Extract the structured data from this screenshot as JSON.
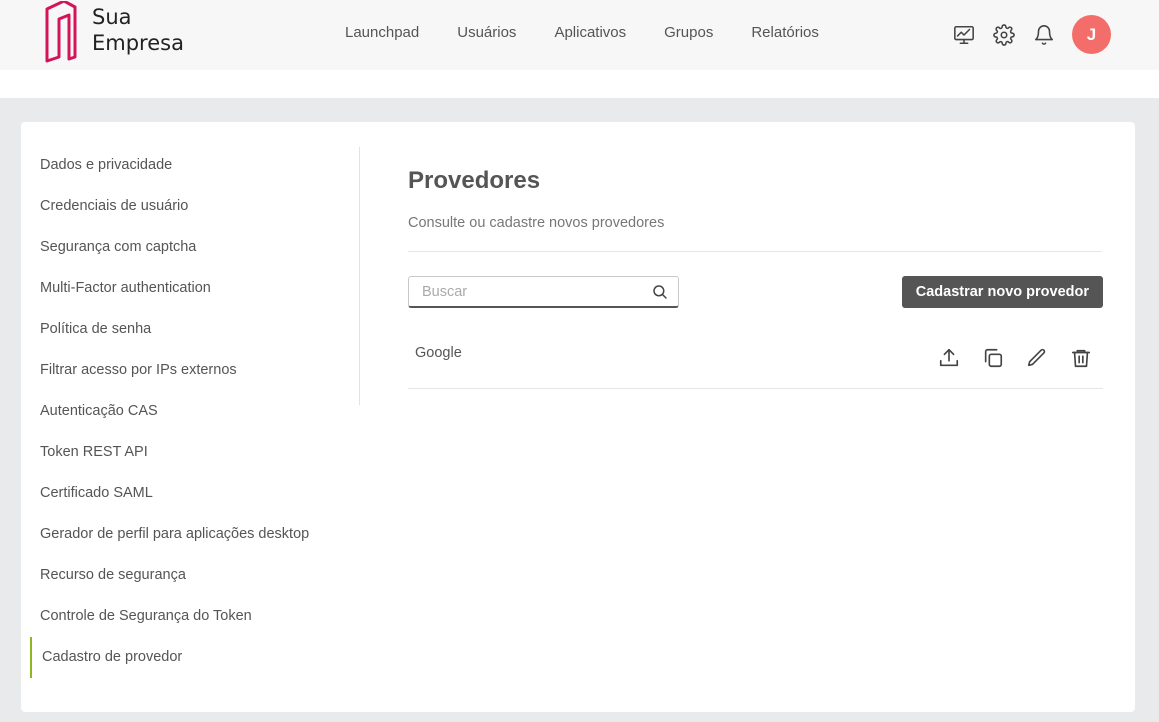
{
  "brand": {
    "line1": "Sua",
    "line2": "Empresa",
    "color": "#d4145a"
  },
  "nav": [
    "Launchpad",
    "Usuários",
    "Aplicativos",
    "Grupos",
    "Relatórios"
  ],
  "header_icons": [
    "monitor-chart-icon",
    "gear-icon",
    "bell-icon"
  ],
  "user": {
    "initial": "J",
    "avatar_color": "#f36d6a"
  },
  "sidebar": {
    "items": [
      "Dados e privacidade",
      "Credenciais de usuário",
      "Segurança com captcha",
      "Multi-Factor authentication",
      "Política de senha",
      "Filtrar acesso por IPs externos",
      "Autenticação CAS",
      "Token REST API",
      "Certificado SAML",
      "Gerador de perfil para aplicações desktop",
      "Recurso de segurança",
      "Controle de Segurança do Token",
      "Cadastro de provedor"
    ],
    "active_index": 12,
    "active_color": "#8fb520"
  },
  "main": {
    "title": "Provedores",
    "subtitle": "Consulte ou cadastre novos provedores",
    "search": {
      "placeholder": "Buscar",
      "value": ""
    },
    "new_button": "Cadastrar novo provedor",
    "providers": [
      {
        "name": "Google",
        "actions": [
          "export-icon",
          "copy-icon",
          "edit-icon",
          "trash-icon"
        ]
      }
    ]
  }
}
